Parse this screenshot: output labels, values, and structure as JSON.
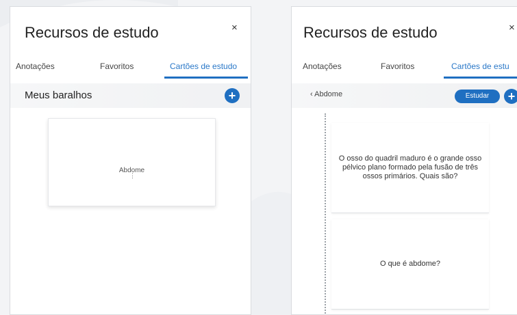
{
  "left_panel": {
    "title": "Recursos de estudo",
    "close": "×",
    "tabs": [
      "Anotações",
      "Favoritos",
      "Cartões de estudo"
    ],
    "active_tab": 2,
    "section_title": "Meus baralhos",
    "add_label": "+",
    "deck": {
      "name": "Abdome",
      "menu": "⋮"
    }
  },
  "right_panel": {
    "title": "Recursos de estudo",
    "close": "×",
    "tabs": [
      "Anotações",
      "Favoritos",
      "Cartões de estu"
    ],
    "active_tab": 2,
    "back_label": "‹ Abdome",
    "study_label": "Estudar",
    "add_label": "+",
    "cards": [
      "O osso do quadril maduro é o grande osso pélvico plano formado pela fusão de três ossos primários. Quais são?",
      "O que é abdome?"
    ]
  },
  "colors": {
    "accent": "#1f6fc1",
    "active_tab_text": "#2a78c8"
  }
}
